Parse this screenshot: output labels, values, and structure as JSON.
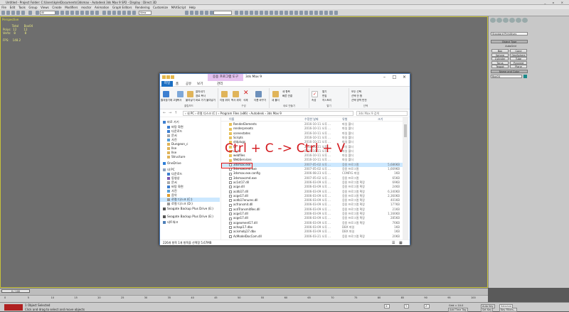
{
  "app": {
    "title": "Untitled    -   Project Folder: C:\\Users\\kyle\\Documents\\3dsmax  -   Autodesk 3ds Max 9 SP2   - Display : Direct 3D",
    "menu": [
      "File",
      "Edit",
      "Tools",
      "Group",
      "Views",
      "Create",
      "Modifiers",
      "reactor",
      "Animation",
      "Graph Editors",
      "Rendering",
      "Customize",
      "MAXScript",
      "Help"
    ],
    "toolbar": {
      "filter_value": "All",
      "view_value": "View"
    },
    "viewport": {
      "label": "Perspective",
      "stats_text": "          Total      Box04\nPolys:  12        12\nVerts:   8          8\n\nFPS:    148.2"
    },
    "command_panel": {
      "category": "Standard Primitives",
      "object_type_header": "Object Type",
      "autogrid": "AutoGrid",
      "buttons": [
        "Box",
        "Cone",
        "Sphere",
        "GeoSphere",
        "Cylinder",
        "Tube",
        "Torus",
        "Pyramid",
        "Teapot",
        "Plane"
      ],
      "name_color_header": "Name and Color",
      "name_value": "Box04"
    },
    "timeline": {
      "slider": "0 / 100"
    },
    "ruler_ticks": [
      "0",
      "5",
      "10",
      "15",
      "20",
      "25",
      "30",
      "35",
      "40",
      "45",
      "50",
      "55",
      "60",
      "65",
      "70",
      "75",
      "80",
      "85",
      "90",
      "95",
      "100"
    ],
    "status": {
      "selection": "1 Object Selected",
      "prompt": "Click and drag to select and move objects",
      "x": "X:",
      "y": "Y:",
      "z": "Z:",
      "grid": "Grid = 10.0",
      "add_time_tag": "Add Time Tag",
      "auto_key": "Auto Key",
      "set_key": "Set Key",
      "selected": "Selected",
      "key_filters": "Key Filters..."
    }
  },
  "explorer": {
    "manage_tab": "응용 프로그램 도구",
    "path_title": "3ds Max 9",
    "ribbon_tabs": [
      "파일",
      "홈",
      "공유",
      "보기",
      "관리"
    ],
    "ribbon": {
      "clipboard": {
        "pin": "즐겨찾기에 고정",
        "copy": "복사",
        "paste": "붙여넣기",
        "cut": "잘라내기",
        "copy_path": "경로 복사",
        "paste_shortcut": "바로 가기 붙여넣기",
        "label": "클립보드"
      },
      "organize": {
        "move": "이동 위치",
        "copy_to": "복사 위치",
        "delete": "삭제",
        "rename": "이름 바꾸기",
        "label": "구성"
      },
      "new": {
        "new_folder": "새 폴더",
        "new_item": "새 항목",
        "easy_access": "빠른 연결",
        "label": "새로 만들기"
      },
      "open": {
        "properties": "속성",
        "open": "열기",
        "edit": "편집",
        "history": "히스토리",
        "label": "열기"
      },
      "select": {
        "all": "모두 선택",
        "none": "선택 안 함",
        "invert": "선택 영역 반전",
        "label": "선택"
      }
    },
    "address": "› 내 PC › 로컬 디스크 (C:) › Program Files (x86) › Autodesk › 3ds Max 9",
    "search_placeholder": "3ds Max 9 검색",
    "nav": [
      "바로 가기",
      "바탕 화면",
      "다운로드",
      "문서",
      "사진",
      "Dungeon_c",
      "Ilse",
      "Ilse",
      "Structure",
      "OneDrive",
      "내 PC",
      "다운로드",
      "동영상",
      "문서",
      "바탕 화면",
      "사진",
      "음악",
      "로컬 디스크 (C:)",
      "로컬 디스크 (D:)",
      "Seagate Backup Plus Drive (E:)",
      "Seagate Backup Plus Drive (E:)",
      "네트워크"
    ],
    "columns": {
      "name": "이름",
      "date": "수정한 날짜",
      "type": "유형",
      "size": "크기"
    },
    "files": [
      {
        "name": "RenderElements",
        "date": "2016-10-11 오후 ...",
        "type": "파일 폴더",
        "size": ""
      },
      {
        "name": "renderpresets",
        "date": "2016-10-11 오후 ...",
        "type": "파일 폴더",
        "size": ""
      },
      {
        "name": "scenestates",
        "date": "2016-10-11 오후 ...",
        "type": "파일 폴더",
        "size": ""
      },
      {
        "name": "Scripts",
        "date": "2016-10-11 오후 ...",
        "type": "파일 폴더",
        "size": ""
      },
      {
        "name": "stdplugs",
        "date": "2016-10-11 오후 ...",
        "type": "파일 폴더",
        "size": ""
      },
      {
        "name": "UI",
        "date": "2016-10-11 오후 ...",
        "type": "파일 폴더",
        "size": ""
      },
      {
        "name": "ui_ln",
        "date": "2016-10-11 오후 ...",
        "type": "파일 폴더",
        "size": ""
      },
      {
        "name": "webfiles",
        "date": "2016-10-11 오후 ...",
        "type": "파일 폴더",
        "size": ""
      },
      {
        "name": "WebServices",
        "date": "2016-10-11 오후 ...",
        "type": "파일 폴더",
        "size": ""
      },
      {
        "name": "3dsmax.exe",
        "date": "2007-05-02 오후 ...",
        "type": "응용 프로그램",
        "size": "5,686KB"
      },
      {
        "name": "3dsmaxcmd.exe",
        "date": "2007-05-02 오후 ...",
        "type": "응용 프로그램",
        "size": "1,669KB"
      },
      {
        "name": "3dsmax.exe.config",
        "date": "2006-08-23 오후 ...",
        "type": "CONFIG 파일",
        "size": "1KB"
      },
      {
        "name": "3dsmaxcmd.exe",
        "date": "2007-05-02 오후 ...",
        "type": "응용 프로그램",
        "size": "65KB"
      },
      {
        "name": "ac1st17.dll",
        "date": "2006-03-09 오후 ...",
        "type": "응용 프로그램 확장",
        "size": "69KB"
      },
      {
        "name": "acge.dll",
        "date": "2006-03-09 오후 ...",
        "type": "응용 프로그램 확장",
        "size": "24KB"
      },
      {
        "name": "acdb17.dll",
        "date": "2006-03-09 오후 ...",
        "type": "응용 프로그램 확장",
        "size": "6,340KB"
      },
      {
        "name": "acge17.dll",
        "date": "2006-03-09 오후 ...",
        "type": "응용 프로그램 확장",
        "size": "2,360KB"
      },
      {
        "name": "acdb17enures.dll",
        "date": "2006-03-09 오후 ...",
        "type": "응용 프로그램 확장",
        "size": "401KB"
      },
      {
        "name": "acfransmit.dll",
        "date": "2006-03-09 오후 ...",
        "type": "응용 프로그램 확장",
        "size": "177KB"
      },
      {
        "name": "acdTransmitRes.dll",
        "date": "2006-03-09 오후 ...",
        "type": "응용 프로그램 확장",
        "size": "21KB"
      },
      {
        "name": "acge17.dll",
        "date": "2006-03-09 오후 ...",
        "type": "응용 프로그램 확장",
        "size": "1,166KB"
      },
      {
        "name": "acge17.dll",
        "date": "2006-03-09 오후 ...",
        "type": "응용 프로그램 확장",
        "size": "285KB"
      },
      {
        "name": "acgeoment17.dll",
        "date": "2006-03-09 오후 ...",
        "type": "응용 프로그램 확장",
        "size": "76KB"
      },
      {
        "name": "achapi17.dbx",
        "date": "2006-03-09 오후 ...",
        "type": "DBX 파일",
        "size": "1KB"
      },
      {
        "name": "acismobj17.dbx",
        "date": "2006-03-09 오후 ...",
        "type": "DBX 파일",
        "size": "1KB"
      },
      {
        "name": "AcModelDocCom.dll",
        "date": "2006-03-21 오후 ...",
        "type": "응용 프로그램 확장",
        "size": "20KB"
      }
    ],
    "status": "226개 항목    1개 항목을 선택함 5.67MB"
  },
  "overlay": {
    "text": "Ctrl + C  -> Ctrl + V",
    "color": "#d3181d"
  }
}
